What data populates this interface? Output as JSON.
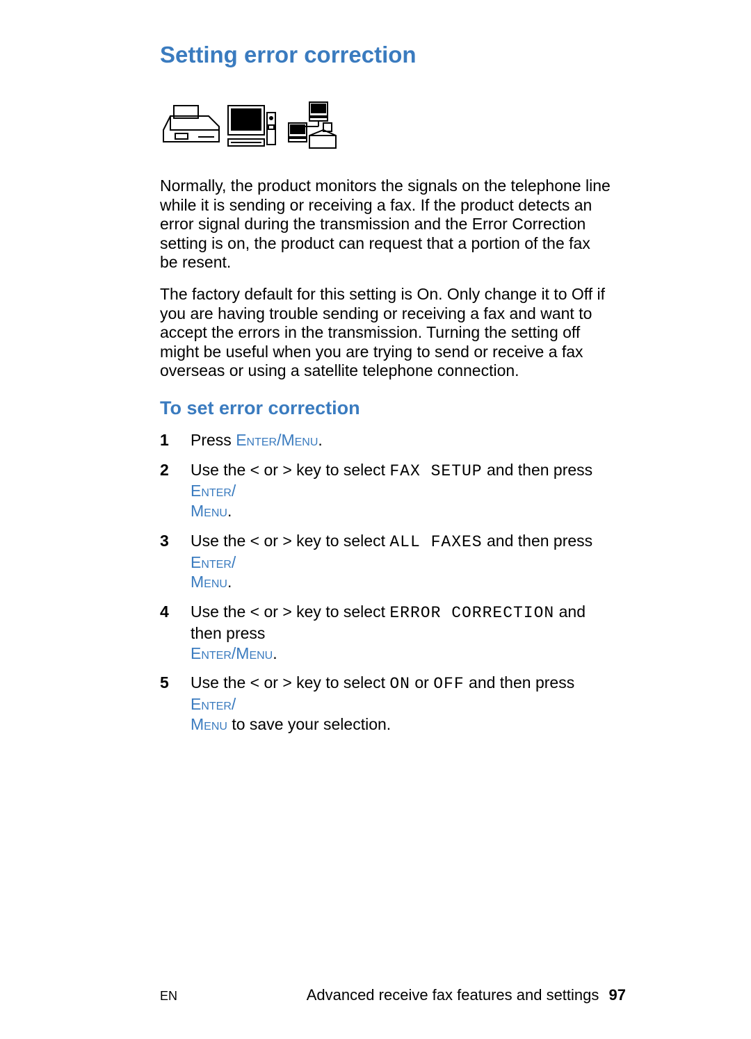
{
  "heading": "Setting error correction",
  "para1": "Normally, the product monitors the signals on the telephone line while it is sending or receiving a fax. If the product detects an error signal during the transmission and the Error Correction setting is on, the product can request that a portion of the fax be resent.",
  "para2": "The factory default for this setting is On. Only change it to Off if you are having trouble sending or receiving a fax and want to accept the errors in the transmission. Turning the setting off might be useful when you are trying to send or receive a fax overseas or using a satellite telephone connection.",
  "subheading": "To set error correction",
  "steps": {
    "s1": {
      "num": "1",
      "t1": "Press ",
      "btn1": "Enter/Menu",
      "t2": "."
    },
    "s2": {
      "num": "2",
      "t1": "Use the < or > key to select ",
      "disp": "FAX SETUP",
      "t2": " and then press ",
      "btn1": "Enter/",
      "btn2": "Menu",
      "t3": "."
    },
    "s3": {
      "num": "3",
      "t1": "Use the < or > key to select ",
      "disp": "ALL FAXES",
      "t2": " and then press ",
      "btn1": "Enter/",
      "btn2": "Menu",
      "t3": "."
    },
    "s4": {
      "num": "4",
      "t1": "Use the < or > key to select ",
      "disp": "ERROR CORRECTION",
      "t2": " and then press ",
      "btn1": "Enter/Menu",
      "t3": "."
    },
    "s5": {
      "num": "5",
      "t1": "Use the < or > key to select ",
      "disp1": "ON",
      "t2": " or ",
      "disp2": "OFF",
      "t3": " and then press ",
      "btn1": "Enter/",
      "btn2": "Menu",
      "t4": " to save your selection."
    }
  },
  "footer": {
    "lang": "EN",
    "section": "Advanced receive fax features and settings",
    "page": "97"
  }
}
